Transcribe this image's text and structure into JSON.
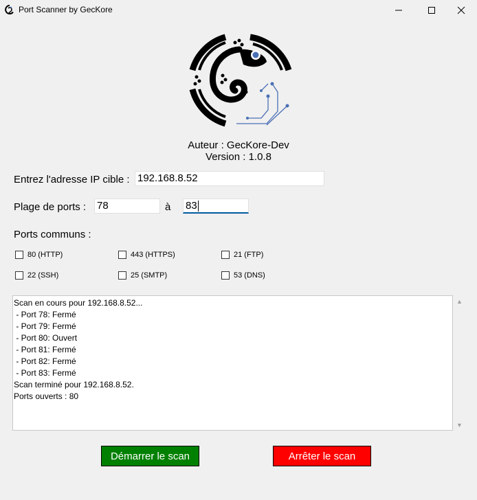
{
  "window": {
    "title": "Port Scanner by GecKore",
    "icon": "gecko-icon",
    "controls": [
      "minimize-icon",
      "maximize-icon",
      "close-icon"
    ]
  },
  "header": {
    "logo": "geckore-logo",
    "author": "Auteur : GecKore-Dev",
    "version": "Version : 1.0.8"
  },
  "form": {
    "ip_label": "Entrez l'adresse IP cible :",
    "ip_value": "192.168.8.52",
    "ports_label": "Plage de ports :",
    "port_start": "78",
    "port_separator": "à",
    "port_end": "83",
    "common_label": "Ports communs :"
  },
  "common_ports": [
    {
      "label": "80 (HTTP)",
      "checked": false
    },
    {
      "label": "443 (HTTPS)",
      "checked": false
    },
    {
      "label": "21 (FTP)",
      "checked": false
    },
    {
      "label": "22 (SSH)",
      "checked": false
    },
    {
      "label": "25 (SMTP)",
      "checked": false
    },
    {
      "label": "53 (DNS)",
      "checked": false
    }
  ],
  "output": {
    "lines": [
      "Scan en cours pour 192.168.8.52...",
      " - Port 78: Fermé",
      " - Port 79: Fermé",
      " - Port 80: Ouvert",
      " - Port 81: Fermé",
      " - Port 82: Fermé",
      " - Port 83: Fermé",
      "Scan terminé pour 192.168.8.52.",
      "Ports ouverts : 80"
    ]
  },
  "buttons": {
    "start_label": "Démarrer le scan",
    "stop_label": "Arrêter le scan"
  },
  "colors": {
    "start": "#008000",
    "stop": "#ff0000",
    "logo_accent": "#4a6fb5"
  }
}
